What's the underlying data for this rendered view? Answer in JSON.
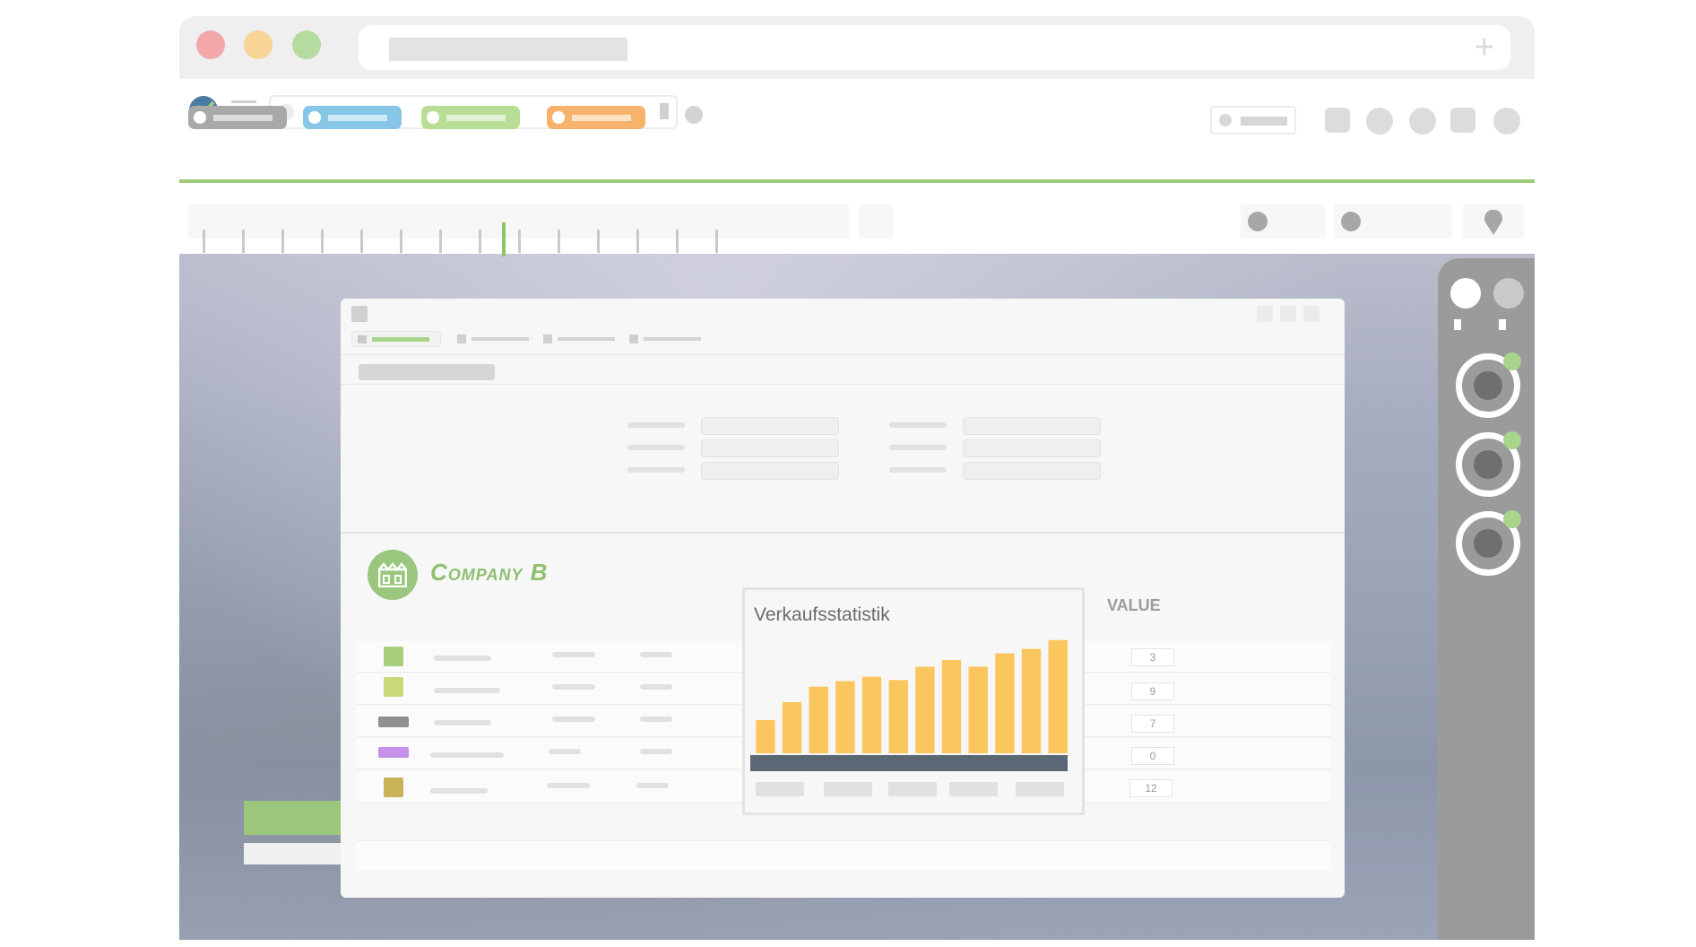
{
  "window": {
    "traffic_colors": [
      "#f2a8a8",
      "#f8d496",
      "#b6dba0"
    ]
  },
  "toolbar": {
    "logo_icon": "chart-logo-icon",
    "menu_icon": "hamburger-menu-icon",
    "filter_pills": [
      {
        "color": "#a9a9a9"
      },
      {
        "color": "#87c6e6"
      },
      {
        "color": "#b8de96"
      },
      {
        "color": "#f7b36c"
      }
    ],
    "accent": "#9ccc78"
  },
  "app": {
    "company_name": "Company B",
    "company_icon": "factory-icon",
    "value_header": "VALUE",
    "rows": [
      {
        "value": "3"
      },
      {
        "value": "9"
      },
      {
        "value": "7"
      },
      {
        "value": "0"
      },
      {
        "value": "12"
      }
    ]
  },
  "chart_popup": {
    "title": "Verkaufsstatistik"
  },
  "chart_data": {
    "type": "bar",
    "title": "Verkaufsstatistik",
    "values": [
      30,
      46,
      60,
      65,
      69,
      66,
      78,
      84,
      78,
      90,
      94,
      102
    ],
    "ylim": [
      0,
      105
    ],
    "bar_color": "#fcc65f"
  },
  "rail": {
    "ring_count": 3,
    "badge_color": "#a8d48c"
  }
}
